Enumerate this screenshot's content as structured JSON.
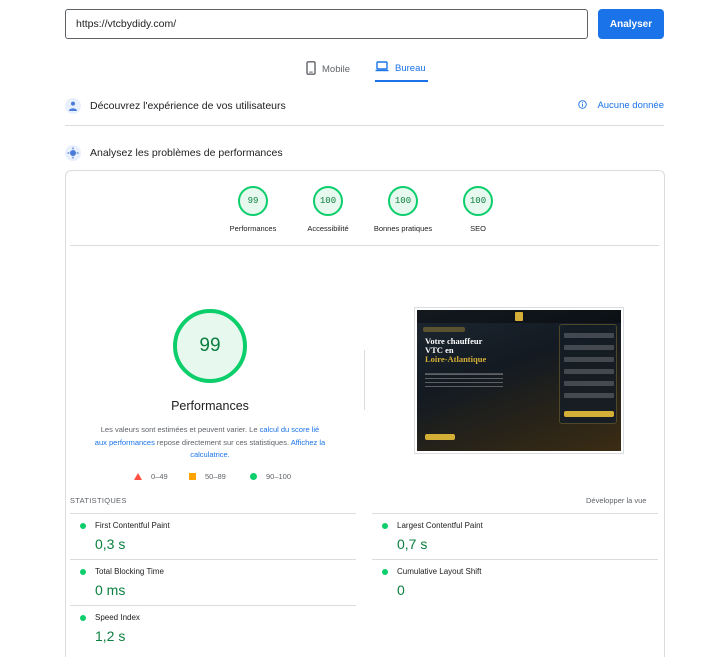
{
  "search": {
    "url_value": "https://vtcbydidy.com/"
  },
  "analyze_label": "Analyser",
  "device_tabs": {
    "mobile": "Mobile",
    "desktop": "Bureau"
  },
  "field_section": {
    "title": "Découvrez l'expérience de vos utilisateurs",
    "no_data": "Aucune donnée"
  },
  "lab_section": {
    "title": "Analysez les problèmes de performances"
  },
  "categories": [
    {
      "score": "99",
      "label": "Performances"
    },
    {
      "score": "100",
      "label": "Accessibilité"
    },
    {
      "score": "100",
      "label": "Bonnes pratiques"
    },
    {
      "score": "100",
      "label": "SEO"
    }
  ],
  "main_gauge": {
    "score": "99",
    "label": "Performances"
  },
  "disclaimer": {
    "part1": "Les valeurs sont estimées et peuvent varier. Le ",
    "link1": "calcul du score lié aux performances",
    "part2": " repose directement sur ces statistiques. ",
    "link2": "Affichez la calculatrice."
  },
  "legend": {
    "low": "0–49",
    "mid": "50–89",
    "high": "90–100"
  },
  "screenshot": {
    "heading_line1": "Votre chauffeur",
    "heading_line2": "VTC en",
    "heading_line3": "Loire-Atlantique"
  },
  "stats": {
    "title": "STATISTIQUES",
    "expand": "Développer la vue",
    "metrics": [
      {
        "name": "First Contentful Paint",
        "value": "0,3 s"
      },
      {
        "name": "Largest Contentful Paint",
        "value": "0,7 s"
      },
      {
        "name": "Total Blocking Time",
        "value": "0 ms"
      },
      {
        "name": "Cumulative Layout Shift",
        "value": "0"
      },
      {
        "name": "Speed Index",
        "value": "1,2 s"
      }
    ]
  },
  "colors": {
    "accent": "#1a73e8",
    "pass": "#0cce6b",
    "average": "#ffa400",
    "fail": "#ff4e42"
  }
}
